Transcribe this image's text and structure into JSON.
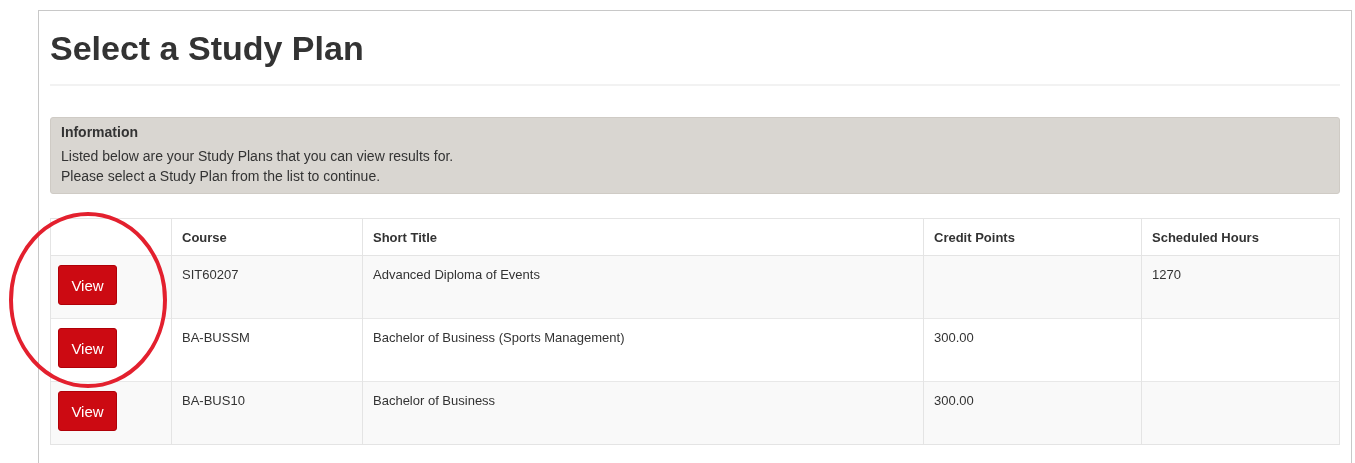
{
  "page": {
    "title": "Select a Study Plan"
  },
  "information": {
    "heading": "Information",
    "lines": [
      "Listed below are your Study Plans that you can view results for.",
      "Please select a Study Plan from the list to continue."
    ]
  },
  "table": {
    "columns": [
      "Course",
      "Short Title",
      "Credit Points",
      "Scheduled Hours"
    ],
    "rows": [
      {
        "button": "View",
        "course": "SIT60207",
        "short_title": "Advanced Diploma of Events",
        "scheduled_hours": "1270"
      },
      {
        "button": "View",
        "course": "BA-BUSSM",
        "short_title": "Bachelor of Business (Sports Management)",
        "credit_points": "300.00"
      },
      {
        "button": "View",
        "course": "BA-BUS10",
        "short_title": "Bachelor of Business",
        "credit_points": "300.00"
      }
    ]
  }
}
